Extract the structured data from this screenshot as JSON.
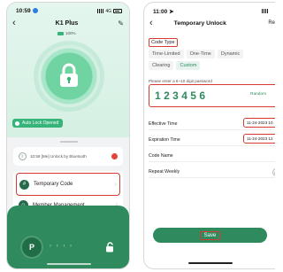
{
  "left": {
    "status_time": "10:59",
    "status_signal": "4G",
    "title": "K1 Plus",
    "battery_text": "100%",
    "auto_lock": "Auto Lock Opened",
    "log_text": "10:58 [Me] Unlock by Bluetooth",
    "menu": [
      {
        "label": "Temporary Code",
        "icon": "#"
      },
      {
        "label": "Member Management",
        "icon": "☺"
      }
    ],
    "unlock_knob": "P",
    "slide_arrows": "› › › ›"
  },
  "right": {
    "status_time": "11:00",
    "title": "Temporary Unlock",
    "action": "Re",
    "code_type_label": "Code Type",
    "code_types_row1": [
      "Time-Limited",
      "One-Time",
      "Dynamic"
    ],
    "code_types_row2": [
      "Clearing",
      "Custom"
    ],
    "active_code_type": "Custom",
    "pwd_hint": "Please enter a 6~10 digit password",
    "password": "123456",
    "random_label": "Random",
    "effective_label": "Effective Time",
    "effective_value": "11-24-2023 10",
    "expiration_label": "Expiration Time",
    "expiration_value": "11-24-2023 12",
    "code_name_label": "Code Name",
    "repeat_label": "Repeat Weekly",
    "save_label": "Save"
  },
  "colors": {
    "accent": "#2f8a5e",
    "highlight": "#d53b30",
    "light_green": "#d5f0e3"
  }
}
